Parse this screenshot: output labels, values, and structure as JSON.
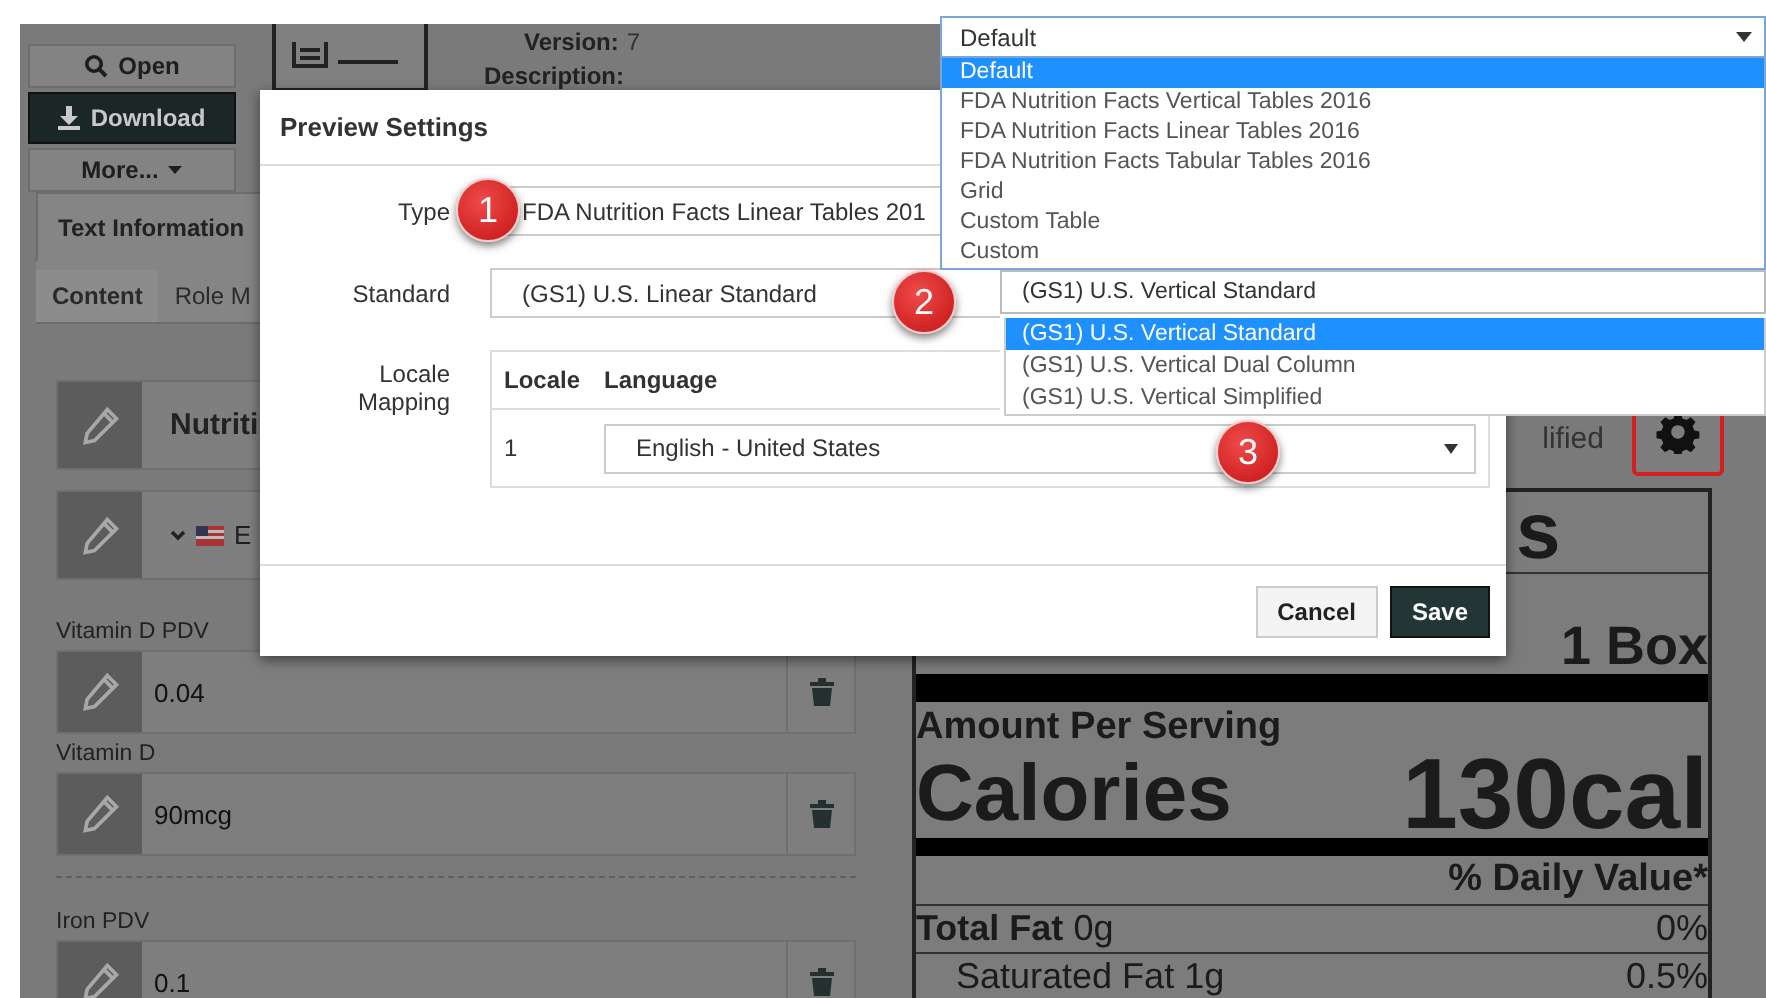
{
  "sidebar_buttons": [
    {
      "label": "Open",
      "kind": "search"
    },
    {
      "label": "Download",
      "kind": "download"
    },
    {
      "label": "More...",
      "kind": "menu"
    }
  ],
  "meta": [
    {
      "label": "Version:",
      "value": "7"
    },
    {
      "label": "Description:"
    }
  ],
  "tabs": [
    {
      "label": "Text Information",
      "selected": true
    }
  ],
  "subtabs": [
    {
      "label": "Content",
      "selected": true
    },
    {
      "label": "Role M",
      "selected": false
    }
  ],
  "content": {
    "title": "Nutriti",
    "language": "E",
    "groups": [
      {
        "fields": [
          {
            "label": "Vitamin D PDV",
            "value": "0.04"
          },
          {
            "label": "Vitamin D",
            "value": "90mcg"
          }
        ]
      },
      {
        "fields": [
          {
            "label": "Iron PDV",
            "value": "0.1"
          }
        ]
      }
    ]
  },
  "preview": {
    "standard_text": "lified",
    "heading": "s",
    "rows": [
      {
        "kind": "serving",
        "value": "1 Box"
      },
      {
        "kind": "bar"
      },
      {
        "kind": "amount",
        "label": "Amount Per Serving"
      },
      {
        "kind": "calories",
        "label": "Calories",
        "value": "130cal"
      },
      {
        "kind": "bar"
      },
      {
        "kind": "dv",
        "label": "% Daily Value*"
      },
      {
        "kind": "nutrient",
        "label": "Total Fat",
        "amount": "0g",
        "percent": "0%"
      },
      {
        "kind": "subnutrient",
        "label": "Saturated Fat",
        "amount": "1g",
        "percent": "0.5%"
      }
    ]
  },
  "dialog": {
    "title": "Preview Settings",
    "type": {
      "label": "Type",
      "value": "FDA Nutrition Facts Linear Tables 201"
    },
    "standard": {
      "label": "Standard",
      "value": "(GS1) U.S. Linear Standard"
    },
    "locale_mapping": {
      "label": "Locale Mapping",
      "columns": [
        "Locale",
        "Language"
      ],
      "rows": [
        {
          "locale": "1",
          "language": "English - United States"
        }
      ]
    },
    "buttons": [
      {
        "label": "Cancel",
        "kind": "secondary"
      },
      {
        "label": "Save",
        "kind": "primary"
      }
    ]
  },
  "type_dropdown": {
    "value": "Default",
    "options": [
      {
        "label": "Default",
        "selected": true
      },
      {
        "label": "FDA Nutrition Facts Vertical Tables 2016",
        "selected": false
      },
      {
        "label": "FDA Nutrition Facts Linear Tables 2016",
        "selected": false
      },
      {
        "label": "FDA Nutrition Facts Tabular Tables 2016",
        "selected": false
      },
      {
        "label": "Grid",
        "selected": false
      },
      {
        "label": "Custom Table",
        "selected": false
      },
      {
        "label": "Custom",
        "selected": false
      }
    ]
  },
  "standard_dropdown": {
    "value": "(GS1) U.S. Vertical Standard",
    "options": [
      {
        "label": "(GS1) U.S. Vertical Standard",
        "selected": true
      },
      {
        "label": "(GS1) U.S. Vertical Dual Column",
        "selected": false
      },
      {
        "label": "(GS1) U.S. Vertical Simplified",
        "selected": false
      }
    ]
  },
  "callouts": [
    "1",
    "2",
    "3"
  ]
}
